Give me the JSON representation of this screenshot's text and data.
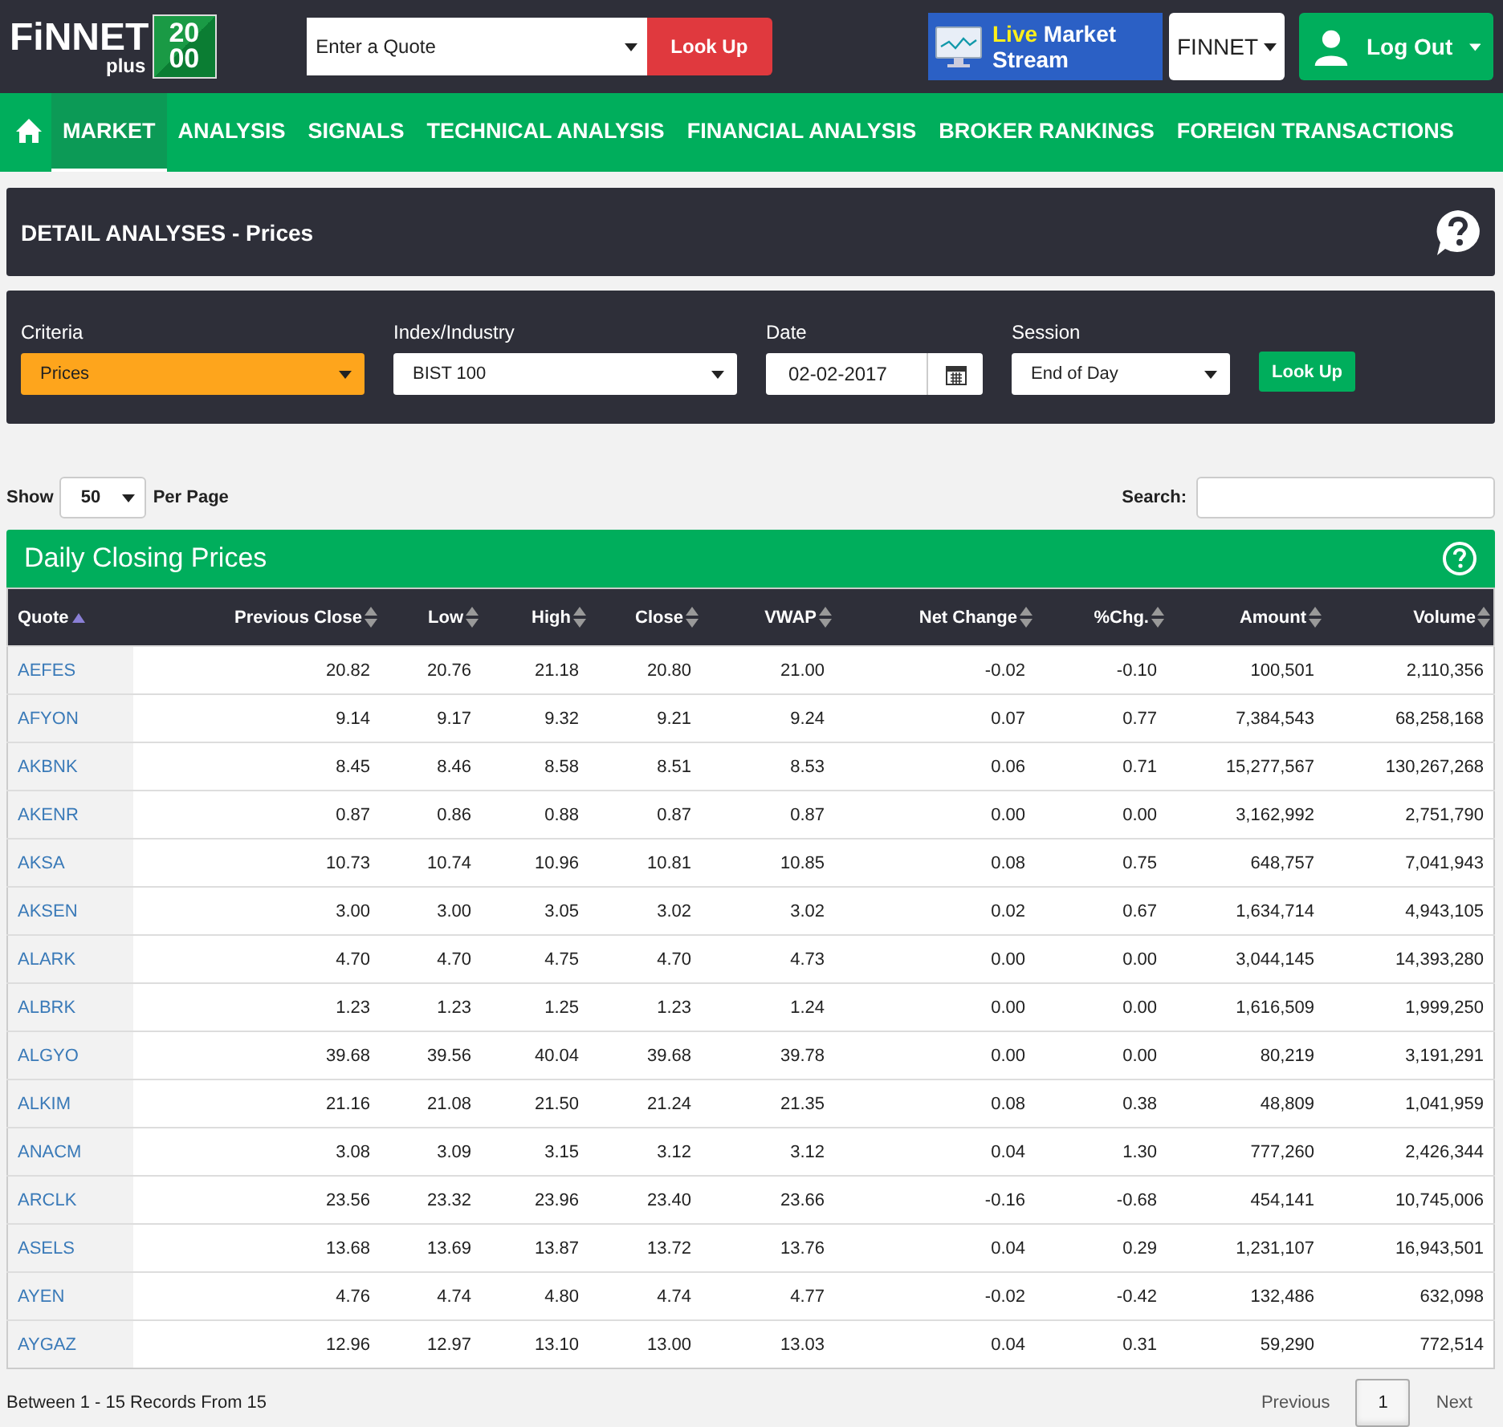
{
  "header": {
    "logo": {
      "name": "FiNNET",
      "sub": "plus",
      "badge": [
        "20",
        "00"
      ]
    },
    "quote_search": {
      "placeholder": "Enter a Quote",
      "button": "Look Up"
    },
    "live_stream": {
      "highlight": "Live",
      "label": "Market Stream"
    },
    "account_menu": "FINNET",
    "logout": "Log Out"
  },
  "nav": [
    {
      "label": "MARKET",
      "selected": true
    },
    {
      "label": "ANALYSIS",
      "selected": false
    },
    {
      "label": "SIGNALS",
      "selected": false
    },
    {
      "label": "TECHNICAL ANALYSIS",
      "selected": false
    },
    {
      "label": "FINANCIAL ANALYSIS",
      "selected": false
    },
    {
      "label": "BROKER RANKINGS",
      "selected": false
    },
    {
      "label": "FOREIGN TRANSACTIONS",
      "selected": false
    }
  ],
  "page_title": "DETAIL ANALYSES - Prices",
  "filters": [
    {
      "kind": "select",
      "label": "Criteria",
      "value": "Prices",
      "highlighted": true
    },
    {
      "kind": "select",
      "label": "Index/Industry",
      "value": "BIST 100",
      "highlighted": false
    },
    {
      "kind": "date",
      "label": "Date",
      "value": "02-02-2017",
      "highlighted": false
    },
    {
      "kind": "select",
      "label": "Session",
      "value": "End of Day",
      "highlighted": false
    }
  ],
  "filter_button": "Look Up",
  "page_size": {
    "before": "Show",
    "value": "50",
    "after": "Per Page"
  },
  "search": {
    "label": "Search:"
  },
  "table": {
    "title": "Daily Closing Prices",
    "columns": [
      {
        "label": "Quote",
        "sorted": true
      },
      {
        "label": "Previous Close",
        "sorted": false
      },
      {
        "label": "Low",
        "sorted": false
      },
      {
        "label": "High",
        "sorted": false
      },
      {
        "label": "Close",
        "sorted": false
      },
      {
        "label": "VWAP",
        "sorted": false
      },
      {
        "label": "Net Change",
        "sorted": false
      },
      {
        "label": "%Chg.",
        "sorted": false
      },
      {
        "label": "Amount",
        "sorted": false
      },
      {
        "label": "Volume",
        "sorted": false
      }
    ],
    "rows": [
      [
        "AEFES",
        "20.82",
        "20.76",
        "21.18",
        "20.80",
        "21.00",
        "-0.02",
        "-0.10",
        "100,501",
        "2,110,356"
      ],
      [
        "AFYON",
        "9.14",
        "9.17",
        "9.32",
        "9.21",
        "9.24",
        "0.07",
        "0.77",
        "7,384,543",
        "68,258,168"
      ],
      [
        "AKBNK",
        "8.45",
        "8.46",
        "8.58",
        "8.51",
        "8.53",
        "0.06",
        "0.71",
        "15,277,567",
        "130,267,268"
      ],
      [
        "AKENR",
        "0.87",
        "0.86",
        "0.88",
        "0.87",
        "0.87",
        "0.00",
        "0.00",
        "3,162,992",
        "2,751,790"
      ],
      [
        "AKSA",
        "10.73",
        "10.74",
        "10.96",
        "10.81",
        "10.85",
        "0.08",
        "0.75",
        "648,757",
        "7,041,943"
      ],
      [
        "AKSEN",
        "3.00",
        "3.00",
        "3.05",
        "3.02",
        "3.02",
        "0.02",
        "0.67",
        "1,634,714",
        "4,943,105"
      ],
      [
        "ALARK",
        "4.70",
        "4.70",
        "4.75",
        "4.70",
        "4.73",
        "0.00",
        "0.00",
        "3,044,145",
        "14,393,280"
      ],
      [
        "ALBRK",
        "1.23",
        "1.23",
        "1.25",
        "1.23",
        "1.24",
        "0.00",
        "0.00",
        "1,616,509",
        "1,999,250"
      ],
      [
        "ALGYO",
        "39.68",
        "39.56",
        "40.04",
        "39.68",
        "39.78",
        "0.00",
        "0.00",
        "80,219",
        "3,191,291"
      ],
      [
        "ALKIM",
        "21.16",
        "21.08",
        "21.50",
        "21.24",
        "21.35",
        "0.08",
        "0.38",
        "48,809",
        "1,041,959"
      ],
      [
        "ANACM",
        "3.08",
        "3.09",
        "3.15",
        "3.12",
        "3.12",
        "0.04",
        "1.30",
        "777,260",
        "2,426,344"
      ],
      [
        "ARCLK",
        "23.56",
        "23.32",
        "23.96",
        "23.40",
        "23.66",
        "-0.16",
        "-0.68",
        "454,141",
        "10,745,006"
      ],
      [
        "ASELS",
        "13.68",
        "13.69",
        "13.87",
        "13.72",
        "13.76",
        "0.04",
        "0.29",
        "1,231,107",
        "16,943,501"
      ],
      [
        "AYEN",
        "4.76",
        "4.74",
        "4.80",
        "4.74",
        "4.77",
        "-0.02",
        "-0.42",
        "132,486",
        "632,098"
      ],
      [
        "AYGAZ",
        "12.96",
        "12.97",
        "13.10",
        "13.00",
        "13.03",
        "0.04",
        "0.31",
        "59,290",
        "772,514"
      ]
    ]
  },
  "records_info": "Between 1 - 15 Records From 15",
  "pagination": [
    {
      "label": "Previous",
      "selected": false
    },
    {
      "label": "1",
      "selected": true
    },
    {
      "label": "Next",
      "selected": false
    }
  ]
}
